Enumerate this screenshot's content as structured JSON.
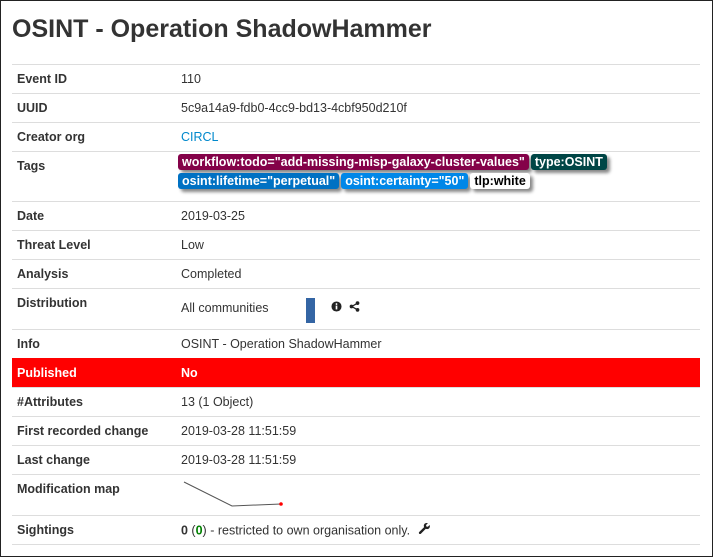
{
  "title": "OSINT - Operation ShadowHammer",
  "fields": {
    "event_id": {
      "label": "Event ID",
      "value": "110"
    },
    "uuid": {
      "label": "UUID",
      "value": "5c9a14a9-fdb0-4cc9-bd13-4cbf950d210f"
    },
    "creator_org": {
      "label": "Creator org",
      "value": "CIRCL"
    },
    "tags": {
      "label": "Tags"
    },
    "date": {
      "label": "Date",
      "value": "2019-03-25"
    },
    "threat_level": {
      "label": "Threat Level",
      "value": "Low"
    },
    "analysis": {
      "label": "Analysis",
      "value": "Completed"
    },
    "distribution": {
      "label": "Distribution",
      "value": "All communities"
    },
    "info": {
      "label": "Info",
      "value": "OSINT - Operation ShadowHammer"
    },
    "published": {
      "label": "Published",
      "value": "No"
    },
    "attributes": {
      "label": "#Attributes",
      "value": "13 (1 Object)"
    },
    "first_change": {
      "label": "First recorded change",
      "value": "2019-03-28 11:51:59"
    },
    "last_change": {
      "label": "Last change",
      "value": "2019-03-28 11:51:59"
    },
    "modification_map": {
      "label": "Modification map"
    },
    "sightings": {
      "label": "Sightings",
      "count": "0",
      "own_count": "0",
      "open_paren": " (",
      "close_paren": ")",
      "suffix": " - restricted to own organisation only."
    }
  },
  "tags": [
    {
      "text": "workflow:todo=\"add-missing-misp-galaxy-cluster-values\"",
      "bg": "#840249",
      "fg": "#ffffff"
    },
    {
      "text": "type:OSINT",
      "bg": "#004646",
      "fg": "#ffffff"
    },
    {
      "text": "osint:lifetime=\"perpetual\"",
      "bg": "#0071c3",
      "fg": "#ffffff"
    },
    {
      "text": "osint:certainty=\"50\"",
      "bg": "#0087e8",
      "fg": "#ffffff"
    },
    {
      "text": "tlp:white",
      "bg": "#ffffff",
      "fg": "#000000"
    }
  ],
  "icons": {
    "info": "info-circle-icon",
    "share": "share-alt-icon",
    "wrench": "wrench-icon"
  },
  "colors": {
    "published_bg": "#ff0000",
    "link": "#0088cc",
    "distribution_bar": "#3465a4",
    "sightings_green": "#008000"
  }
}
